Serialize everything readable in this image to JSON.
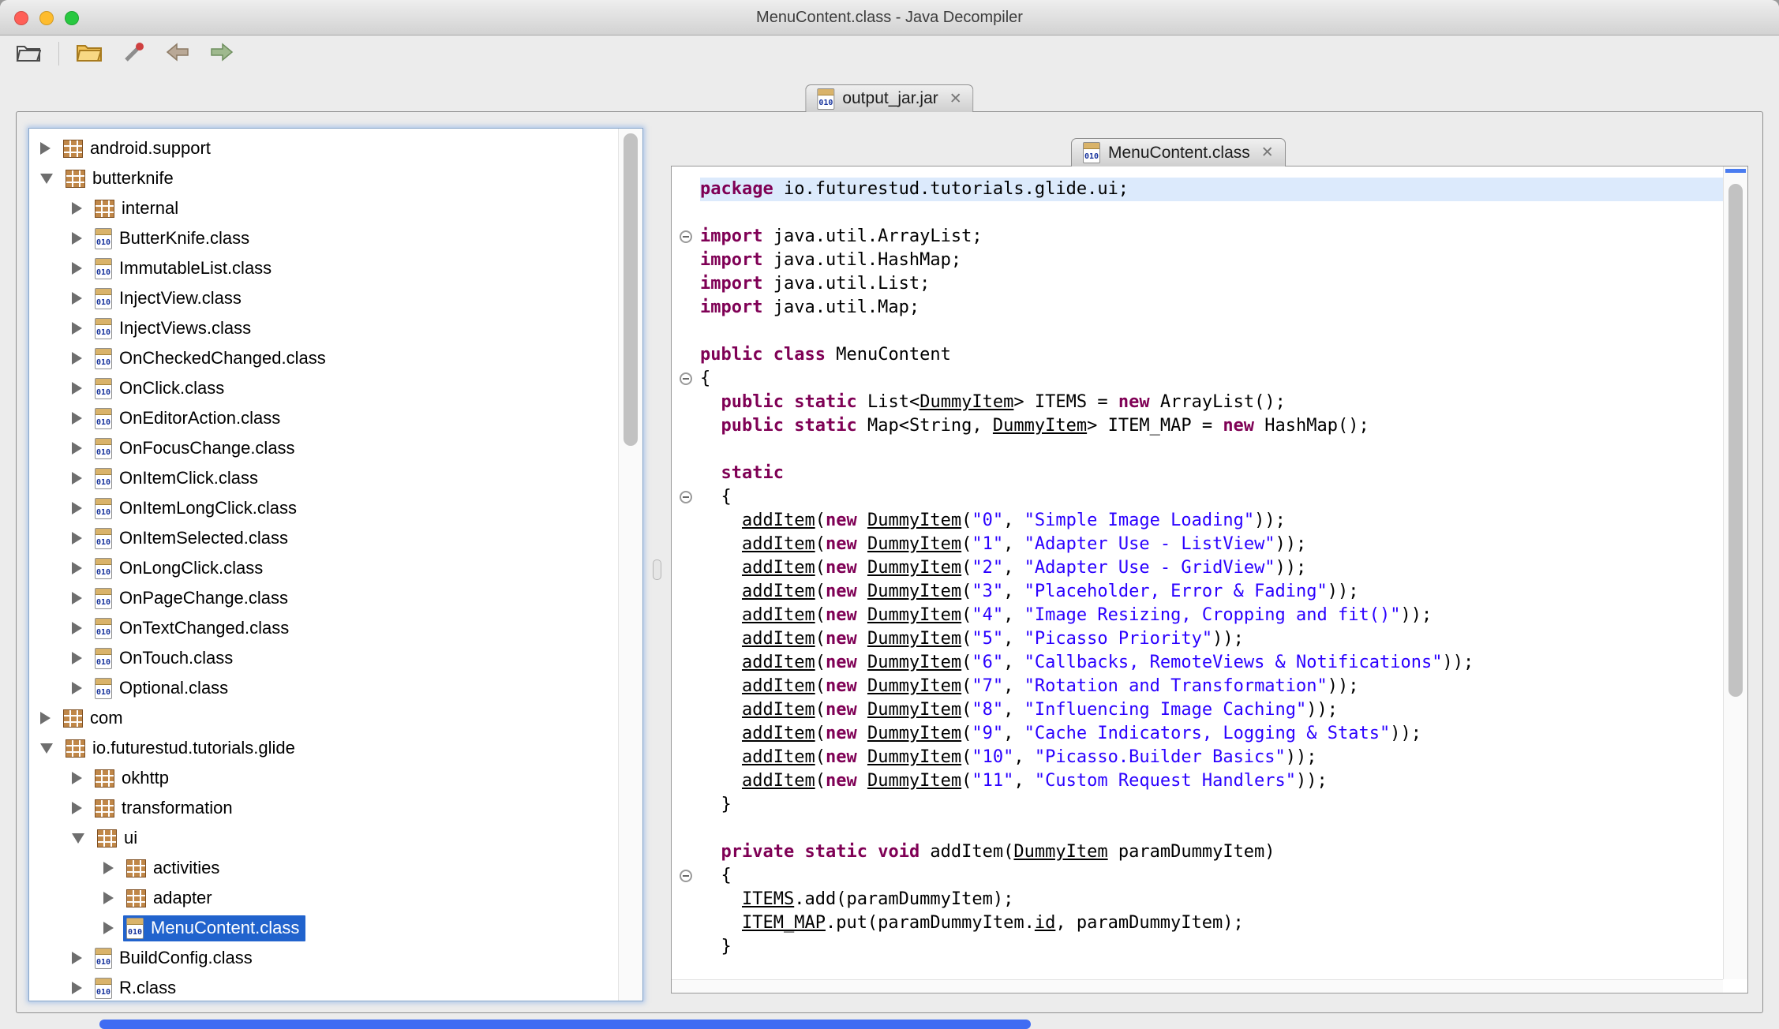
{
  "window": {
    "title": "MenuContent.class - Java Decompiler"
  },
  "icons": {
    "class_glyph": "010",
    "close_glyph": "✕"
  },
  "jar_tab": {
    "label": "output_jar.jar"
  },
  "code_tab": {
    "label": "MenuContent.class"
  },
  "tree": {
    "items": [
      {
        "label": "android.support",
        "icon": "package",
        "arrow": "right",
        "indent": 0
      },
      {
        "label": "butterknife",
        "icon": "package",
        "arrow": "down",
        "indent": 0
      },
      {
        "label": "internal",
        "icon": "package",
        "arrow": "right",
        "indent": 1
      },
      {
        "label": "ButterKnife.class",
        "icon": "class",
        "arrow": "right",
        "indent": 1
      },
      {
        "label": "ImmutableList.class",
        "icon": "class",
        "arrow": "right",
        "indent": 1
      },
      {
        "label": "InjectView.class",
        "icon": "class",
        "arrow": "right",
        "indent": 1
      },
      {
        "label": "InjectViews.class",
        "icon": "class",
        "arrow": "right",
        "indent": 1
      },
      {
        "label": "OnCheckedChanged.class",
        "icon": "class",
        "arrow": "right",
        "indent": 1
      },
      {
        "label": "OnClick.class",
        "icon": "class",
        "arrow": "right",
        "indent": 1
      },
      {
        "label": "OnEditorAction.class",
        "icon": "class",
        "arrow": "right",
        "indent": 1
      },
      {
        "label": "OnFocusChange.class",
        "icon": "class",
        "arrow": "right",
        "indent": 1
      },
      {
        "label": "OnItemClick.class",
        "icon": "class",
        "arrow": "right",
        "indent": 1
      },
      {
        "label": "OnItemLongClick.class",
        "icon": "class",
        "arrow": "right",
        "indent": 1
      },
      {
        "label": "OnItemSelected.class",
        "icon": "class",
        "arrow": "right",
        "indent": 1
      },
      {
        "label": "OnLongClick.class",
        "icon": "class",
        "arrow": "right",
        "indent": 1
      },
      {
        "label": "OnPageChange.class",
        "icon": "class",
        "arrow": "right",
        "indent": 1
      },
      {
        "label": "OnTextChanged.class",
        "icon": "class",
        "arrow": "right",
        "indent": 1
      },
      {
        "label": "OnTouch.class",
        "icon": "class",
        "arrow": "right",
        "indent": 1
      },
      {
        "label": "Optional.class",
        "icon": "class",
        "arrow": "right",
        "indent": 1
      },
      {
        "label": "com",
        "icon": "package",
        "arrow": "right",
        "indent": 0
      },
      {
        "label": "io.futurestud.tutorials.glide",
        "icon": "package",
        "arrow": "down",
        "indent": 0
      },
      {
        "label": "okhttp",
        "icon": "package",
        "arrow": "right",
        "indent": 1
      },
      {
        "label": "transformation",
        "icon": "package",
        "arrow": "right",
        "indent": 1
      },
      {
        "label": "ui",
        "icon": "package",
        "arrow": "down",
        "indent": 1
      },
      {
        "label": "activities",
        "icon": "package",
        "arrow": "right",
        "indent": 2
      },
      {
        "label": "adapter",
        "icon": "package",
        "arrow": "right",
        "indent": 2
      },
      {
        "label": "MenuContent.class",
        "icon": "class",
        "arrow": "right",
        "indent": 2,
        "selected": true
      },
      {
        "label": "BuildConfig.class",
        "icon": "class",
        "arrow": "right",
        "indent": 1
      },
      {
        "label": "R.class",
        "icon": "class",
        "arrow": "right",
        "indent": 1
      }
    ]
  },
  "code": {
    "lines": [
      {
        "hl": true,
        "segs": [
          [
            "kw",
            "package"
          ],
          [
            "pl",
            " io.futurestud.tutorials.glide.ui;"
          ]
        ]
      },
      {
        "segs": []
      },
      {
        "fold": true,
        "segs": [
          [
            "kw",
            "import"
          ],
          [
            "pl",
            " java.util.ArrayList;"
          ]
        ]
      },
      {
        "segs": [
          [
            "kw",
            "import"
          ],
          [
            "pl",
            " java.util.HashMap;"
          ]
        ]
      },
      {
        "segs": [
          [
            "kw",
            "import"
          ],
          [
            "pl",
            " java.util.List;"
          ]
        ]
      },
      {
        "segs": [
          [
            "kw",
            "import"
          ],
          [
            "pl",
            " java.util.Map;"
          ]
        ]
      },
      {
        "segs": []
      },
      {
        "segs": [
          [
            "kw",
            "public"
          ],
          [
            "pl",
            " "
          ],
          [
            "kw",
            "class"
          ],
          [
            "pl",
            " MenuContent"
          ]
        ]
      },
      {
        "fold": true,
        "segs": [
          [
            "pl",
            "{"
          ]
        ]
      },
      {
        "segs": [
          [
            "pl",
            "  "
          ],
          [
            "kw",
            "public"
          ],
          [
            "pl",
            " "
          ],
          [
            "kw",
            "static"
          ],
          [
            "pl",
            " List<"
          ],
          [
            "lnk",
            "DummyItem"
          ],
          [
            "pl",
            "> ITEMS = "
          ],
          [
            "kw",
            "new"
          ],
          [
            "pl",
            " ArrayList();"
          ]
        ]
      },
      {
        "segs": [
          [
            "pl",
            "  "
          ],
          [
            "kw",
            "public"
          ],
          [
            "pl",
            " "
          ],
          [
            "kw",
            "static"
          ],
          [
            "pl",
            " Map<String, "
          ],
          [
            "lnk",
            "DummyItem"
          ],
          [
            "pl",
            "> ITEM_MAP = "
          ],
          [
            "kw",
            "new"
          ],
          [
            "pl",
            " HashMap();"
          ]
        ]
      },
      {
        "segs": []
      },
      {
        "segs": [
          [
            "pl",
            "  "
          ],
          [
            "kw",
            "static"
          ]
        ]
      },
      {
        "fold": true,
        "segs": [
          [
            "pl",
            "  {"
          ]
        ]
      },
      {
        "segs": [
          [
            "pl",
            "    "
          ],
          [
            "lnk",
            "addItem"
          ],
          [
            "pl",
            "("
          ],
          [
            "kw",
            "new"
          ],
          [
            "pl",
            " "
          ],
          [
            "lnk",
            "DummyItem"
          ],
          [
            "pl",
            "("
          ],
          [
            "str",
            "\"0\""
          ],
          [
            "pl",
            ", "
          ],
          [
            "str",
            "\"Simple Image Loading\""
          ],
          [
            "pl",
            "));"
          ]
        ]
      },
      {
        "segs": [
          [
            "pl",
            "    "
          ],
          [
            "lnk",
            "addItem"
          ],
          [
            "pl",
            "("
          ],
          [
            "kw",
            "new"
          ],
          [
            "pl",
            " "
          ],
          [
            "lnk",
            "DummyItem"
          ],
          [
            "pl",
            "("
          ],
          [
            "str",
            "\"1\""
          ],
          [
            "pl",
            ", "
          ],
          [
            "str",
            "\"Adapter Use - ListView\""
          ],
          [
            "pl",
            "));"
          ]
        ]
      },
      {
        "segs": [
          [
            "pl",
            "    "
          ],
          [
            "lnk",
            "addItem"
          ],
          [
            "pl",
            "("
          ],
          [
            "kw",
            "new"
          ],
          [
            "pl",
            " "
          ],
          [
            "lnk",
            "DummyItem"
          ],
          [
            "pl",
            "("
          ],
          [
            "str",
            "\"2\""
          ],
          [
            "pl",
            ", "
          ],
          [
            "str",
            "\"Adapter Use - GridView\""
          ],
          [
            "pl",
            "));"
          ]
        ]
      },
      {
        "segs": [
          [
            "pl",
            "    "
          ],
          [
            "lnk",
            "addItem"
          ],
          [
            "pl",
            "("
          ],
          [
            "kw",
            "new"
          ],
          [
            "pl",
            " "
          ],
          [
            "lnk",
            "DummyItem"
          ],
          [
            "pl",
            "("
          ],
          [
            "str",
            "\"3\""
          ],
          [
            "pl",
            ", "
          ],
          [
            "str",
            "\"Placeholder, Error & Fading\""
          ],
          [
            "pl",
            "));"
          ]
        ]
      },
      {
        "segs": [
          [
            "pl",
            "    "
          ],
          [
            "lnk",
            "addItem"
          ],
          [
            "pl",
            "("
          ],
          [
            "kw",
            "new"
          ],
          [
            "pl",
            " "
          ],
          [
            "lnk",
            "DummyItem"
          ],
          [
            "pl",
            "("
          ],
          [
            "str",
            "\"4\""
          ],
          [
            "pl",
            ", "
          ],
          [
            "str",
            "\"Image Resizing, Cropping and fit()\""
          ],
          [
            "pl",
            "));"
          ]
        ]
      },
      {
        "segs": [
          [
            "pl",
            "    "
          ],
          [
            "lnk",
            "addItem"
          ],
          [
            "pl",
            "("
          ],
          [
            "kw",
            "new"
          ],
          [
            "pl",
            " "
          ],
          [
            "lnk",
            "DummyItem"
          ],
          [
            "pl",
            "("
          ],
          [
            "str",
            "\"5\""
          ],
          [
            "pl",
            ", "
          ],
          [
            "str",
            "\"Picasso Priority\""
          ],
          [
            "pl",
            "));"
          ]
        ]
      },
      {
        "segs": [
          [
            "pl",
            "    "
          ],
          [
            "lnk",
            "addItem"
          ],
          [
            "pl",
            "("
          ],
          [
            "kw",
            "new"
          ],
          [
            "pl",
            " "
          ],
          [
            "lnk",
            "DummyItem"
          ],
          [
            "pl",
            "("
          ],
          [
            "str",
            "\"6\""
          ],
          [
            "pl",
            ", "
          ],
          [
            "str",
            "\"Callbacks, RemoteViews & Notifications\""
          ],
          [
            "pl",
            "));"
          ]
        ]
      },
      {
        "segs": [
          [
            "pl",
            "    "
          ],
          [
            "lnk",
            "addItem"
          ],
          [
            "pl",
            "("
          ],
          [
            "kw",
            "new"
          ],
          [
            "pl",
            " "
          ],
          [
            "lnk",
            "DummyItem"
          ],
          [
            "pl",
            "("
          ],
          [
            "str",
            "\"7\""
          ],
          [
            "pl",
            ", "
          ],
          [
            "str",
            "\"Rotation and Transformation\""
          ],
          [
            "pl",
            "));"
          ]
        ]
      },
      {
        "segs": [
          [
            "pl",
            "    "
          ],
          [
            "lnk",
            "addItem"
          ],
          [
            "pl",
            "("
          ],
          [
            "kw",
            "new"
          ],
          [
            "pl",
            " "
          ],
          [
            "lnk",
            "DummyItem"
          ],
          [
            "pl",
            "("
          ],
          [
            "str",
            "\"8\""
          ],
          [
            "pl",
            ", "
          ],
          [
            "str",
            "\"Influencing Image Caching\""
          ],
          [
            "pl",
            "));"
          ]
        ]
      },
      {
        "segs": [
          [
            "pl",
            "    "
          ],
          [
            "lnk",
            "addItem"
          ],
          [
            "pl",
            "("
          ],
          [
            "kw",
            "new"
          ],
          [
            "pl",
            " "
          ],
          [
            "lnk",
            "DummyItem"
          ],
          [
            "pl",
            "("
          ],
          [
            "str",
            "\"9\""
          ],
          [
            "pl",
            ", "
          ],
          [
            "str",
            "\"Cache Indicators, Logging & Stats\""
          ],
          [
            "pl",
            "));"
          ]
        ]
      },
      {
        "segs": [
          [
            "pl",
            "    "
          ],
          [
            "lnk",
            "addItem"
          ],
          [
            "pl",
            "("
          ],
          [
            "kw",
            "new"
          ],
          [
            "pl",
            " "
          ],
          [
            "lnk",
            "DummyItem"
          ],
          [
            "pl",
            "("
          ],
          [
            "str",
            "\"10\""
          ],
          [
            "pl",
            ", "
          ],
          [
            "str",
            "\"Picasso.Builder Basics\""
          ],
          [
            "pl",
            "));"
          ]
        ]
      },
      {
        "segs": [
          [
            "pl",
            "    "
          ],
          [
            "lnk",
            "addItem"
          ],
          [
            "pl",
            "("
          ],
          [
            "kw",
            "new"
          ],
          [
            "pl",
            " "
          ],
          [
            "lnk",
            "DummyItem"
          ],
          [
            "pl",
            "("
          ],
          [
            "str",
            "\"11\""
          ],
          [
            "pl",
            ", "
          ],
          [
            "str",
            "\"Custom Request Handlers\""
          ],
          [
            "pl",
            "));"
          ]
        ]
      },
      {
        "segs": [
          [
            "pl",
            "  }"
          ]
        ]
      },
      {
        "segs": []
      },
      {
        "segs": [
          [
            "pl",
            "  "
          ],
          [
            "kw",
            "private"
          ],
          [
            "pl",
            " "
          ],
          [
            "kw",
            "static"
          ],
          [
            "pl",
            " "
          ],
          [
            "kw",
            "void"
          ],
          [
            "pl",
            " addItem("
          ],
          [
            "lnk",
            "DummyItem"
          ],
          [
            "pl",
            " paramDummyItem)"
          ]
        ]
      },
      {
        "fold": true,
        "segs": [
          [
            "pl",
            "  {"
          ]
        ]
      },
      {
        "segs": [
          [
            "pl",
            "    "
          ],
          [
            "lnk",
            "ITEMS"
          ],
          [
            "pl",
            ".add(paramDummyItem);"
          ]
        ]
      },
      {
        "segs": [
          [
            "pl",
            "    "
          ],
          [
            "lnk",
            "ITEM_MAP"
          ],
          [
            "pl",
            ".put(paramDummyItem."
          ],
          [
            "lnk",
            "id"
          ],
          [
            "pl",
            ", paramDummyItem);"
          ]
        ]
      },
      {
        "segs": [
          [
            "pl",
            "  }"
          ]
        ]
      }
    ]
  }
}
